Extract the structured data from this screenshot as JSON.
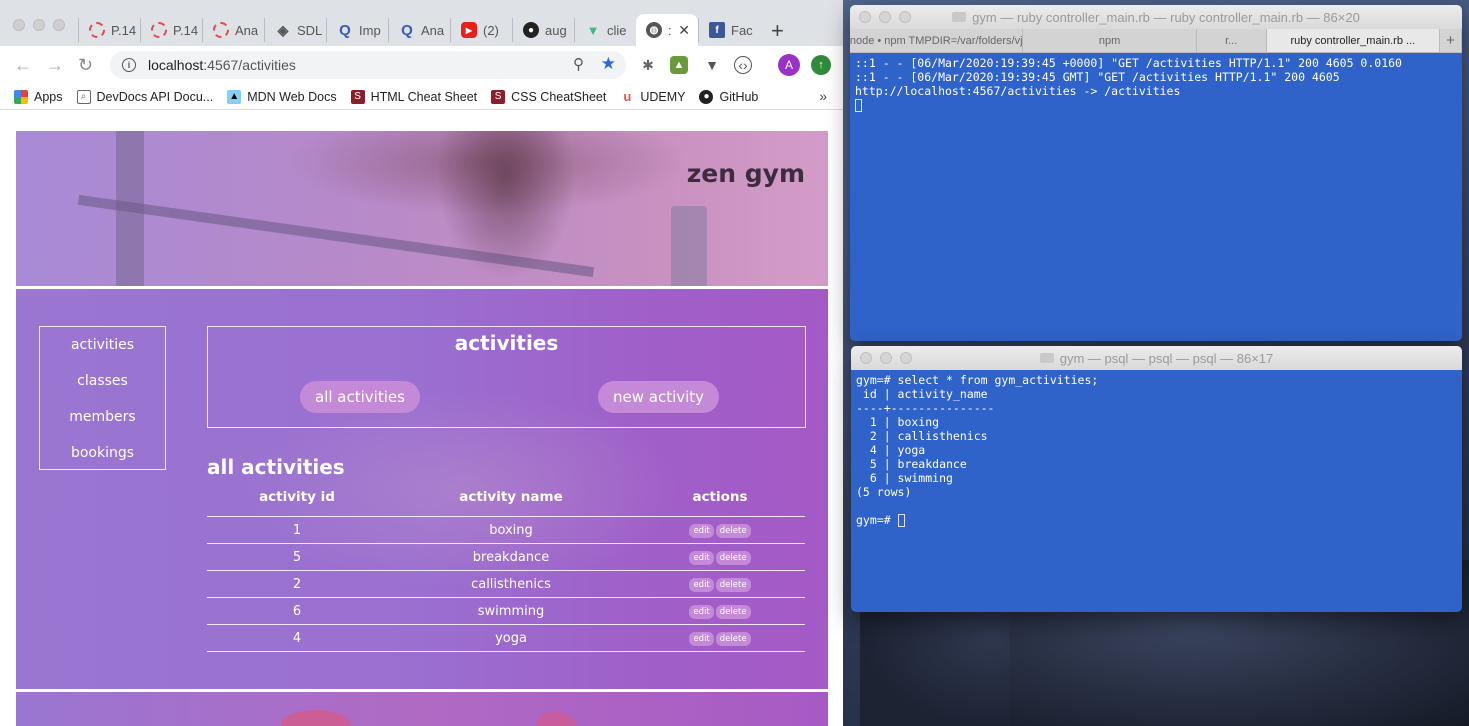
{
  "browser": {
    "tabs": [
      {
        "label": "P.14",
        "icon": "circle-red-icon",
        "color": "#e04b4b"
      },
      {
        "label": "P.14",
        "icon": "circle-red-icon",
        "color": "#e04b4b"
      },
      {
        "label": "Ana",
        "icon": "circle-red-icon",
        "color": "#e04b4b"
      },
      {
        "label": "SDL",
        "icon": "diamond-icon",
        "color": "#555555"
      },
      {
        "label": "Imp",
        "icon": "q-icon",
        "color": "#3b5bb5"
      },
      {
        "label": "Ana",
        "icon": "q-icon",
        "color": "#3b5bb5"
      },
      {
        "label": "(2)",
        "icon": "youtube-icon",
        "color": "#e62117"
      },
      {
        "label": "aug",
        "icon": "github-icon",
        "color": "#222222"
      },
      {
        "label": "clie",
        "icon": "vue-icon",
        "color": "#41b883"
      },
      {
        "label": ":",
        "icon": "globe-icon",
        "color": "#555555"
      },
      {
        "label": "Face",
        "icon": "facebook-icon",
        "color": "#3b5998"
      }
    ],
    "url_host": "localhost",
    "url_rest": ":4567/activities",
    "bookmarks": [
      {
        "label": "Apps",
        "icon": "apps-grid-icon"
      },
      {
        "label": "DevDocs API Docu...",
        "icon": "devdocs-icon"
      },
      {
        "label": "MDN Web Docs",
        "icon": "mdn-icon"
      },
      {
        "label": "HTML Cheat Sheet",
        "icon": "cheatsheet-icon"
      },
      {
        "label": "CSS CheatSheet",
        "icon": "cheatsheet-icon"
      },
      {
        "label": "UDEMY",
        "icon": "udemy-icon"
      },
      {
        "label": "GitHub",
        "icon": "github-icon"
      }
    ],
    "profile_initial": "A"
  },
  "page": {
    "site_title": "zen gym",
    "nav": [
      "activities",
      "classes",
      "members",
      "bookings"
    ],
    "section_title": "activities",
    "buttons": {
      "all": "all activities",
      "new": "new activity"
    },
    "list_title": "all activities",
    "columns": [
      "activity id",
      "activity name",
      "actions"
    ],
    "rows": [
      {
        "id": "1",
        "name": "boxing"
      },
      {
        "id": "5",
        "name": "breakdance"
      },
      {
        "id": "2",
        "name": "callisthenics"
      },
      {
        "id": "6",
        "name": "swimming"
      },
      {
        "id": "4",
        "name": "yoga"
      }
    ],
    "row_actions": {
      "edit": "edit",
      "delete": "delete"
    }
  },
  "terminal_top": {
    "title": "gym — ruby controller_main.rb — ruby controller_main.rb — 86×20",
    "tabs": [
      "node • npm TMPDIR=/var/folders/vj",
      "npm",
      "r...",
      "ruby controller_main.rb ..."
    ],
    "lines": [
      "::1 - - [06/Mar/2020:19:39:45 +0000] \"GET /activities HTTP/1.1\" 200 4605 0.0160",
      "::1 - - [06/Mar/2020:19:39:45 GMT] \"GET /activities HTTP/1.1\" 200 4605",
      "http://localhost:4567/activities -> /activities"
    ]
  },
  "terminal_bottom": {
    "title": "gym — psql — psql — psql — 86×17",
    "lines": [
      "gym=# select * from gym_activities;",
      " id | activity_name",
      "----+---------------",
      "  1 | boxing",
      "  2 | callisthenics",
      "  4 | yoga",
      "  5 | breakdance",
      "  6 | swimming",
      "(5 rows)",
      "",
      "gym=# "
    ]
  }
}
